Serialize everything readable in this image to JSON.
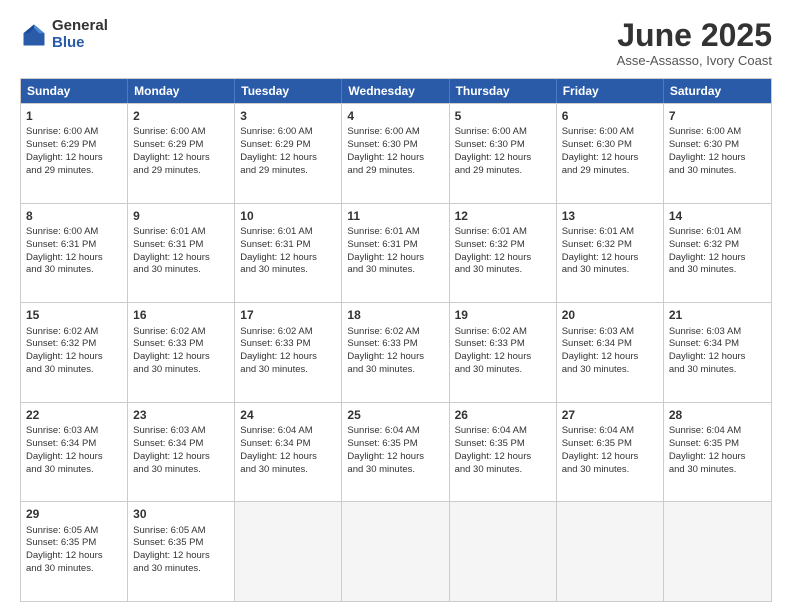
{
  "logo": {
    "general": "General",
    "blue": "Blue"
  },
  "header": {
    "month": "June 2025",
    "location": "Asse-Assasso, Ivory Coast"
  },
  "weekdays": [
    "Sunday",
    "Monday",
    "Tuesday",
    "Wednesday",
    "Thursday",
    "Friday",
    "Saturday"
  ],
  "rows": [
    [
      {
        "day": "1",
        "lines": [
          "Sunrise: 6:00 AM",
          "Sunset: 6:29 PM",
          "Daylight: 12 hours",
          "and 29 minutes."
        ]
      },
      {
        "day": "2",
        "lines": [
          "Sunrise: 6:00 AM",
          "Sunset: 6:29 PM",
          "Daylight: 12 hours",
          "and 29 minutes."
        ]
      },
      {
        "day": "3",
        "lines": [
          "Sunrise: 6:00 AM",
          "Sunset: 6:29 PM",
          "Daylight: 12 hours",
          "and 29 minutes."
        ]
      },
      {
        "day": "4",
        "lines": [
          "Sunrise: 6:00 AM",
          "Sunset: 6:30 PM",
          "Daylight: 12 hours",
          "and 29 minutes."
        ]
      },
      {
        "day": "5",
        "lines": [
          "Sunrise: 6:00 AM",
          "Sunset: 6:30 PM",
          "Daylight: 12 hours",
          "and 29 minutes."
        ]
      },
      {
        "day": "6",
        "lines": [
          "Sunrise: 6:00 AM",
          "Sunset: 6:30 PM",
          "Daylight: 12 hours",
          "and 29 minutes."
        ]
      },
      {
        "day": "7",
        "lines": [
          "Sunrise: 6:00 AM",
          "Sunset: 6:30 PM",
          "Daylight: 12 hours",
          "and 30 minutes."
        ]
      }
    ],
    [
      {
        "day": "8",
        "lines": [
          "Sunrise: 6:00 AM",
          "Sunset: 6:31 PM",
          "Daylight: 12 hours",
          "and 30 minutes."
        ]
      },
      {
        "day": "9",
        "lines": [
          "Sunrise: 6:01 AM",
          "Sunset: 6:31 PM",
          "Daylight: 12 hours",
          "and 30 minutes."
        ]
      },
      {
        "day": "10",
        "lines": [
          "Sunrise: 6:01 AM",
          "Sunset: 6:31 PM",
          "Daylight: 12 hours",
          "and 30 minutes."
        ]
      },
      {
        "day": "11",
        "lines": [
          "Sunrise: 6:01 AM",
          "Sunset: 6:31 PM",
          "Daylight: 12 hours",
          "and 30 minutes."
        ]
      },
      {
        "day": "12",
        "lines": [
          "Sunrise: 6:01 AM",
          "Sunset: 6:32 PM",
          "Daylight: 12 hours",
          "and 30 minutes."
        ]
      },
      {
        "day": "13",
        "lines": [
          "Sunrise: 6:01 AM",
          "Sunset: 6:32 PM",
          "Daylight: 12 hours",
          "and 30 minutes."
        ]
      },
      {
        "day": "14",
        "lines": [
          "Sunrise: 6:01 AM",
          "Sunset: 6:32 PM",
          "Daylight: 12 hours",
          "and 30 minutes."
        ]
      }
    ],
    [
      {
        "day": "15",
        "lines": [
          "Sunrise: 6:02 AM",
          "Sunset: 6:32 PM",
          "Daylight: 12 hours",
          "and 30 minutes."
        ]
      },
      {
        "day": "16",
        "lines": [
          "Sunrise: 6:02 AM",
          "Sunset: 6:33 PM",
          "Daylight: 12 hours",
          "and 30 minutes."
        ]
      },
      {
        "day": "17",
        "lines": [
          "Sunrise: 6:02 AM",
          "Sunset: 6:33 PM",
          "Daylight: 12 hours",
          "and 30 minutes."
        ]
      },
      {
        "day": "18",
        "lines": [
          "Sunrise: 6:02 AM",
          "Sunset: 6:33 PM",
          "Daylight: 12 hours",
          "and 30 minutes."
        ]
      },
      {
        "day": "19",
        "lines": [
          "Sunrise: 6:02 AM",
          "Sunset: 6:33 PM",
          "Daylight: 12 hours",
          "and 30 minutes."
        ]
      },
      {
        "day": "20",
        "lines": [
          "Sunrise: 6:03 AM",
          "Sunset: 6:34 PM",
          "Daylight: 12 hours",
          "and 30 minutes."
        ]
      },
      {
        "day": "21",
        "lines": [
          "Sunrise: 6:03 AM",
          "Sunset: 6:34 PM",
          "Daylight: 12 hours",
          "and 30 minutes."
        ]
      }
    ],
    [
      {
        "day": "22",
        "lines": [
          "Sunrise: 6:03 AM",
          "Sunset: 6:34 PM",
          "Daylight: 12 hours",
          "and 30 minutes."
        ]
      },
      {
        "day": "23",
        "lines": [
          "Sunrise: 6:03 AM",
          "Sunset: 6:34 PM",
          "Daylight: 12 hours",
          "and 30 minutes."
        ]
      },
      {
        "day": "24",
        "lines": [
          "Sunrise: 6:04 AM",
          "Sunset: 6:34 PM",
          "Daylight: 12 hours",
          "and 30 minutes."
        ]
      },
      {
        "day": "25",
        "lines": [
          "Sunrise: 6:04 AM",
          "Sunset: 6:35 PM",
          "Daylight: 12 hours",
          "and 30 minutes."
        ]
      },
      {
        "day": "26",
        "lines": [
          "Sunrise: 6:04 AM",
          "Sunset: 6:35 PM",
          "Daylight: 12 hours",
          "and 30 minutes."
        ]
      },
      {
        "day": "27",
        "lines": [
          "Sunrise: 6:04 AM",
          "Sunset: 6:35 PM",
          "Daylight: 12 hours",
          "and 30 minutes."
        ]
      },
      {
        "day": "28",
        "lines": [
          "Sunrise: 6:04 AM",
          "Sunset: 6:35 PM",
          "Daylight: 12 hours",
          "and 30 minutes."
        ]
      }
    ],
    [
      {
        "day": "29",
        "lines": [
          "Sunrise: 6:05 AM",
          "Sunset: 6:35 PM",
          "Daylight: 12 hours",
          "and 30 minutes."
        ]
      },
      {
        "day": "30",
        "lines": [
          "Sunrise: 6:05 AM",
          "Sunset: 6:35 PM",
          "Daylight: 12 hours",
          "and 30 minutes."
        ]
      },
      {
        "day": "",
        "lines": []
      },
      {
        "day": "",
        "lines": []
      },
      {
        "day": "",
        "lines": []
      },
      {
        "day": "",
        "lines": []
      },
      {
        "day": "",
        "lines": []
      }
    ]
  ]
}
